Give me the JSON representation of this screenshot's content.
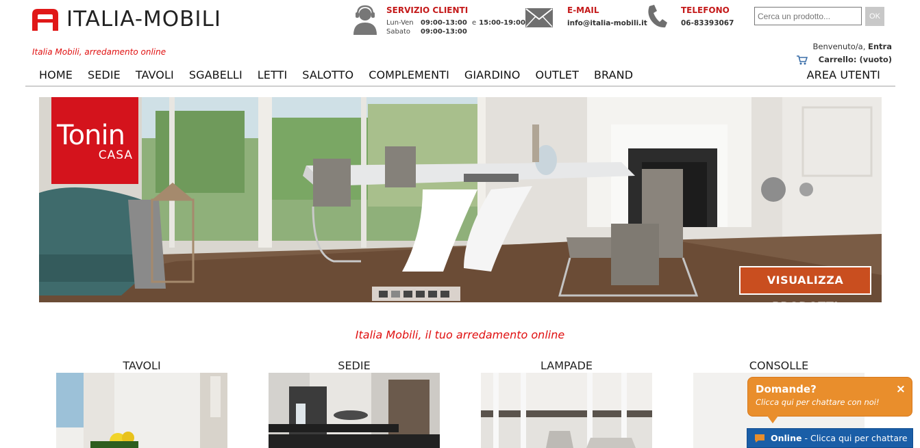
{
  "header": {
    "logo_text": "ITALIA-MOBILI",
    "tagline": "Italia Mobili, arredamento online",
    "service": {
      "title": "SERVIZIO CLIENTI",
      "weekday_label": "Lun-Ven",
      "weekday_hours_1": "09:00-13:00",
      "weekday_and": "e",
      "weekday_hours_2": "15:00-19:00",
      "saturday_label": "Sabato",
      "saturday_hours": "09:00-13:00"
    },
    "email": {
      "title": "E-MAIL",
      "value": "info@italia-mobili.it"
    },
    "phone": {
      "title": "TELEFONO",
      "value": "06-83393067"
    },
    "search": {
      "placeholder": "Cerca un prodotto...",
      "button": "OK"
    },
    "account": {
      "welcome": "Benvenuto/a,",
      "login": "Entra",
      "cart": "Carrello: (vuoto)"
    }
  },
  "nav": {
    "items": [
      "HOME",
      "SEDIE",
      "TAVOLI",
      "SGABELLI",
      "LETTI",
      "SALOTTO",
      "COMPLEMENTI",
      "GIARDINO",
      "OUTLET",
      "BRAND"
    ],
    "right": "AREA UTENTI"
  },
  "banner": {
    "brand_name": "Tonin",
    "brand_sub": "CASA",
    "cta": "VISUALIZZA PRODOTTI",
    "slides": 6,
    "active_slide": 2
  },
  "subtitle": "Italia Mobili, il tuo arredamento online",
  "categories": [
    "TAVOLI",
    "SEDIE",
    "LAMPADE",
    "CONSOLLE"
  ],
  "chat": {
    "question": "Domande?",
    "prompt": "Clicca qui per chattare con noi!",
    "close": "×",
    "status": "Online",
    "bar_text": "- Clicca qui per chattare"
  },
  "colors": {
    "brand_red": "#d4131c",
    "title_red": "#c41a1a",
    "cta_orange": "#c94e1f",
    "chat_orange": "#e98e2c",
    "chat_blue": "#1a5ea7"
  }
}
